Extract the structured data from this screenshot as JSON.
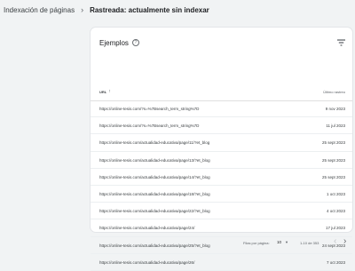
{
  "breadcrumb": {
    "parent": "Indexación de páginas",
    "separator": "›",
    "current": "Rastreada: actualmente sin indexar"
  },
  "card": {
    "title": "Ejemplos",
    "help_icon": "help-circle-icon",
    "filter_icon": "filter-icon"
  },
  "table": {
    "columns": {
      "url": "URL",
      "date": "Último rastreo"
    },
    "sort_icon": "arrow-up-icon",
    "rows": [
      {
        "url": "https://online-tesis.com/?s=%7Bsearch_term_string%7D",
        "date": "9 nov 2023"
      },
      {
        "url": "https://online-tesis.com/?s=%7Bsearch_term_string%7D",
        "date": "11 jul 2023"
      },
      {
        "url": "https://online-tesis.com/actualidad-educativa/page/11/?et_blog",
        "date": "25 sept 2023"
      },
      {
        "url": "https://online-tesis.com/actualidad-educativa/page/13/?et_blog",
        "date": "25 sept 2023"
      },
      {
        "url": "https://online-tesis.com/actualidad-educativa/page/14/?et_blog",
        "date": "25 sept 2023"
      },
      {
        "url": "https://online-tesis.com/actualidad-educativa/page/18/?et_blog",
        "date": "1 oct 2023"
      },
      {
        "url": "https://online-tesis.com/actualidad-educativa/page/22/?et_blog",
        "date": "4 oct 2023"
      },
      {
        "url": "https://online-tesis.com/actualidad-educativa/page/24/",
        "date": "17 jul 2023"
      },
      {
        "url": "https://online-tesis.com/actualidad-educativa/page/25/?et_blog",
        "date": "24 sept 2023"
      },
      {
        "url": "https://online-tesis.com/actualidad-educativa/page/26/",
        "date": "7 oct 2023"
      }
    ]
  },
  "pagination": {
    "rows_per_page_label": "Filas por página:",
    "rows_per_page_value": "10",
    "range": "1-10 de 353",
    "prev_icon": "chevron-left-icon",
    "next_icon": "chevron-right-icon"
  }
}
